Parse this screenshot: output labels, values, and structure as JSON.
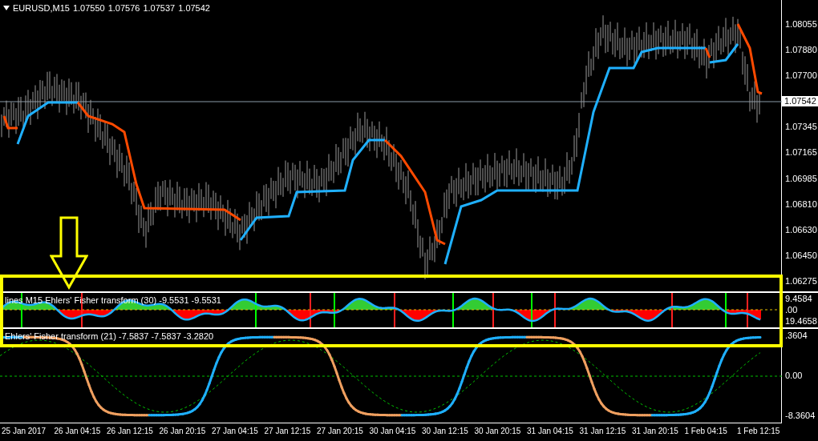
{
  "chart": {
    "symbol": "EURUSD,M15",
    "ohlc": [
      "1.07550",
      "1.07576",
      "1.07537",
      "1.07542"
    ]
  },
  "price_axis": {
    "labels_above": [
      "1.08055",
      "1.07880",
      "1.07700"
    ],
    "current_price": "1.07542",
    "labels_below": [
      "1.07345",
      "1.07165",
      "1.06985",
      "1.06810",
      "1.06630",
      "1.06450",
      "1.06275"
    ]
  },
  "indicator_1": {
    "label": "lines M15 Ehlers' Fisher transform (30) -9.5531 -9.5531",
    "axis_labels": [
      "9.4584",
      ".00",
      "19.4658"
    ]
  },
  "indicator_2": {
    "label": "Ehlers' Fisher transform (21) -7.5837 -7.5837 -3.2820",
    "axis_labels": [
      ".3604",
      "0.00",
      "-8.3604"
    ]
  },
  "time_axis": [
    "25 Jan 2017",
    "26 Jan 04:15",
    "26 Jan 12:15",
    "26 Jan 20:15",
    "27 Jan 04:15",
    "27 Jan 12:15",
    "27 Jan 20:15",
    "30 Jan 04:15",
    "30 Jan 12:15",
    "30 Jan 20:15",
    "31 Jan 04:15",
    "31 Jan 12:15",
    "31 Jan 20:15",
    "1 Feb 04:15",
    "1 Feb 12:15"
  ]
}
